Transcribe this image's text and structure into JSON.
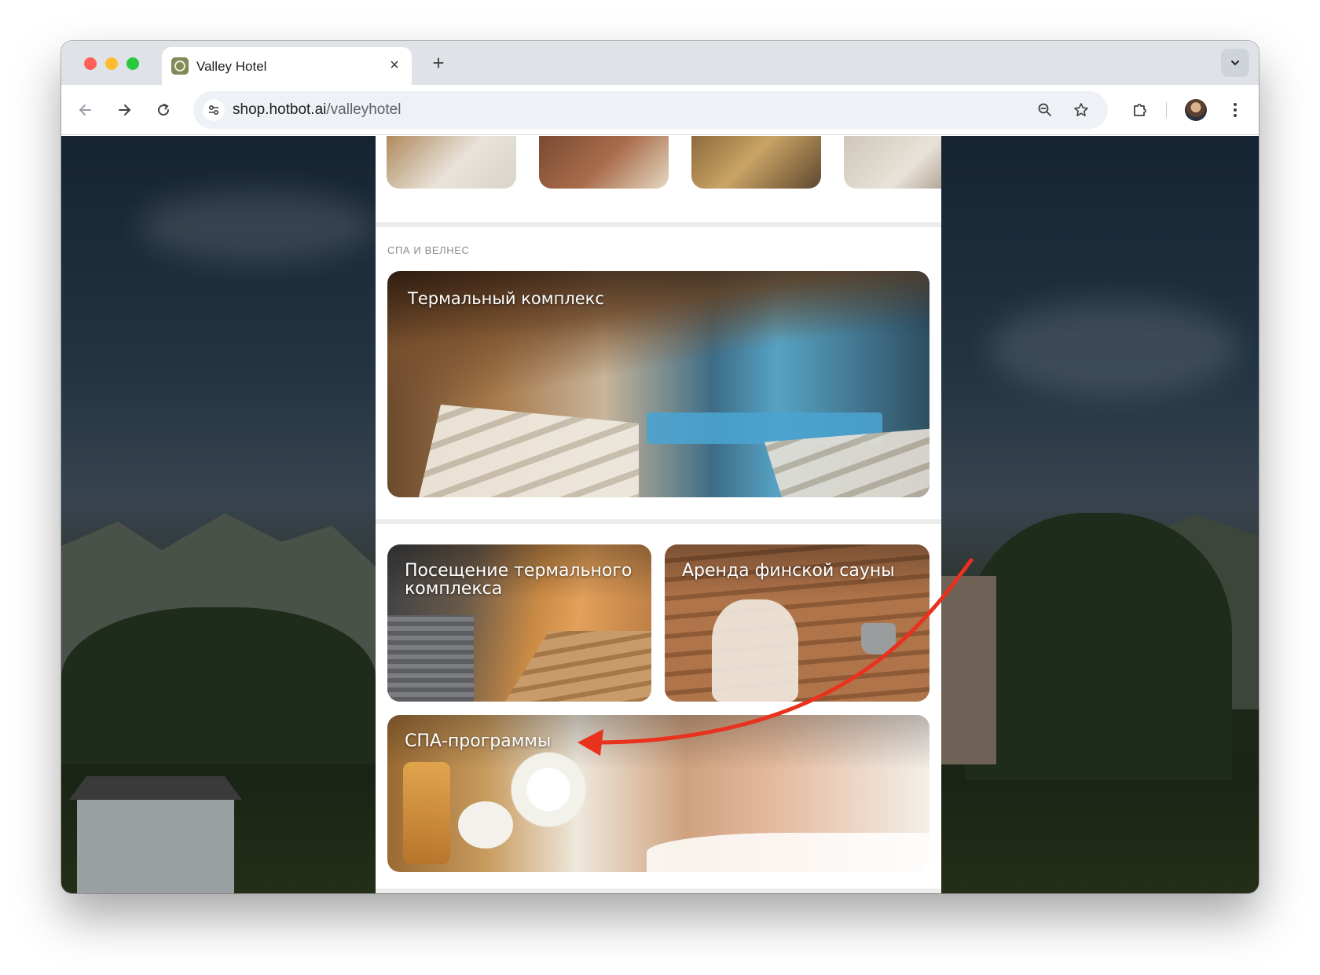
{
  "browser": {
    "tab_title": "Valley Hotel",
    "tab_close": "×",
    "new_tab": "+",
    "url_host": "shop.hotbot.ai",
    "url_path": "/valleyhotel",
    "icons": {
      "back": "arrow-left-icon",
      "forward": "arrow-right-icon",
      "reload": "reload-icon",
      "site_info": "tune-icon",
      "zoom": "zoom-out-icon",
      "bookmark": "star-icon",
      "extensions": "puzzle-icon",
      "menu": "kebab-menu-icon",
      "tab_search": "chevron-down-icon"
    }
  },
  "page": {
    "section_label": "СПА И ВЕЛНЕС",
    "hero_card": {
      "title": "Термальный комплекс"
    },
    "cards": [
      {
        "title": "Посещение термального комплекса"
      },
      {
        "title": "Аренда финской сауны"
      },
      {
        "title": "СПА-программы"
      }
    ]
  },
  "colors": {
    "annotation_arrow": "#e8321e",
    "panel_bg": "#ffffff",
    "section_label": "#8a8a8a"
  }
}
